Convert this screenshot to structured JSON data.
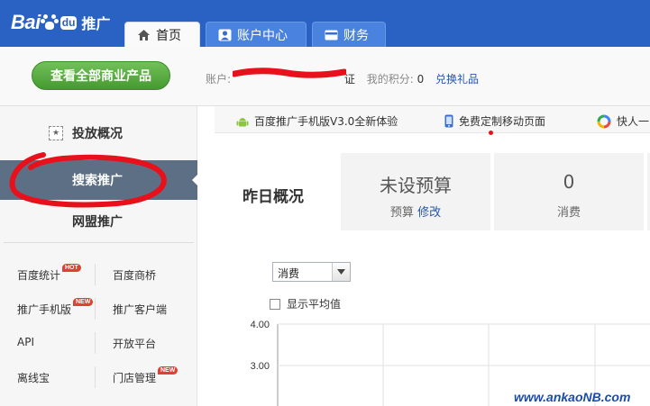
{
  "header": {
    "logo_bai": "Bai",
    "logo_du": "du",
    "logo_text": "推广",
    "tabs": [
      {
        "label": "首页",
        "icon": "home-icon",
        "active": true
      },
      {
        "label": "账户中心",
        "icon": "user-icon",
        "active": false
      },
      {
        "label": "财务",
        "icon": "card-icon",
        "active": false
      }
    ],
    "bar_color": "#2a62c4"
  },
  "subheader": {
    "view_all_button": "查看全部商业产品",
    "account_label": "账户:",
    "account_value_tail": "证",
    "points_label": "我的积分:",
    "points_value": "0",
    "redeem_link": "兑换礼品"
  },
  "sidebar": {
    "items": [
      {
        "label": "投放概况",
        "icon": "overview-icon",
        "active": false
      },
      {
        "label": "搜索推广",
        "active": true
      },
      {
        "label": "网盟推广",
        "active": false
      }
    ],
    "tools": [
      {
        "label": "百度统计",
        "badge": "HOT"
      },
      {
        "label": "百度商桥",
        "badge": ""
      },
      {
        "label": "推广手机版",
        "badge": "NEW"
      },
      {
        "label": "推广客户端",
        "badge": ""
      },
      {
        "label": "API",
        "badge": ""
      },
      {
        "label": "开放平台",
        "badge": ""
      },
      {
        "label": "离线宝",
        "badge": ""
      },
      {
        "label": "门店管理",
        "badge": "NEW"
      }
    ]
  },
  "promos": [
    {
      "label": "百度推广手机版V3.0全新体验",
      "icon": "android-icon"
    },
    {
      "label": "免费定制移动页面",
      "icon": "phone-icon"
    },
    {
      "label": "快人一",
      "icon": "color-ring-icon"
    }
  ],
  "overview": {
    "title": "昨日概况",
    "budget_value": "未设预算",
    "budget_label": "预算",
    "budget_modify": "修改",
    "spend_value": "0",
    "spend_label": "消费"
  },
  "chart_controls": {
    "metric_selected": "消费",
    "show_average_label": "显示平均值",
    "show_average_checked": false
  },
  "chart_data": {
    "type": "line",
    "title": "",
    "y_ticks": [
      "4.00",
      "3.00"
    ],
    "ylim": [
      0,
      4
    ],
    "grid": true,
    "series": []
  },
  "watermark": "www.ankaoNB.com",
  "colors": {
    "accent_blue": "#2a62c4",
    "green_button": "#459a2f",
    "sidebar_active": "#5d6f85",
    "badge_red": "#e2402e",
    "annotation_red": "#e8101a"
  }
}
